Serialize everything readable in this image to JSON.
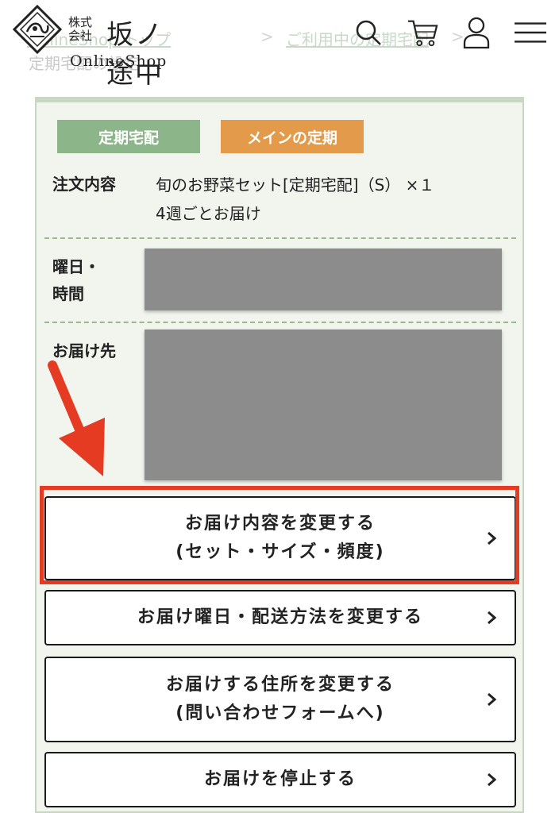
{
  "header": {
    "logo_corp": "株式会社",
    "logo_name": "坂ノ途中",
    "logo_sub": "OnlineShop",
    "icons": [
      "search-icon",
      "cart-icon",
      "user-icon",
      "menu-icon"
    ]
  },
  "breadcrumb": {
    "item1": "OnlineShop トップ",
    "item2": "ご利用中の定期宅配",
    "item3": "定期宅配の設定",
    "separator": ">"
  },
  "card": {
    "badges": [
      "定期宅配",
      "メインの定期"
    ],
    "order_label": "注文内容",
    "order_line1": "旬のお野菜セット[定期宅配]（S） ×１",
    "order_line2": "4週ごとお届け",
    "day_label_line1": "曜日・",
    "day_label_line2": "時間",
    "address_label": "お届け先"
  },
  "buttons": {
    "change_contents_line1": "お届け内容を変更する",
    "change_contents_line2": "(セット・サイズ・頻度)",
    "change_day": "お届け曜日・配送方法を変更する",
    "change_address_line1": "お届けする住所を変更する",
    "change_address_line2": "(問い合わせフォームへ)",
    "stop": "お届けを停止する"
  },
  "colors": {
    "badge_green": "#8db58a",
    "badge_orange": "#e39a4a",
    "card_bg": "#f1f5ee",
    "highlight": "#e43b22"
  }
}
